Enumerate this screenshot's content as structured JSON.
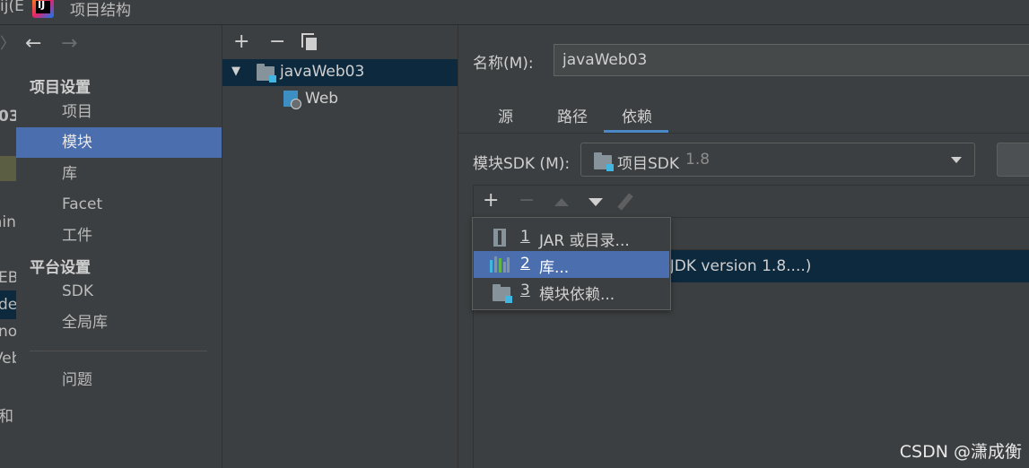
{
  "window": {
    "bg_title_fragment": "ij(E",
    "app_logo_text": "IJ",
    "title": "项目结构"
  },
  "background_ide": {
    "fragments": [
      "〉",
      "03",
      "ain",
      "EB",
      "de",
      "no",
      "Veb",
      "和"
    ]
  },
  "nav": {
    "back_icon": "arrow-left-icon",
    "forward_icon": "arrow-right-icon",
    "section_project": "项目设置",
    "items_project": [
      "项目",
      "模块",
      "库",
      "Facet",
      "工件"
    ],
    "section_platform": "平台设置",
    "items_platform": [
      "SDK",
      "全局库"
    ],
    "problems": "问题",
    "selected": "模块"
  },
  "tree": {
    "toolbar": {
      "add": "+",
      "remove": "−"
    },
    "module": "javaWeb03",
    "facet": "Web"
  },
  "content": {
    "name_label": "名称(M):",
    "name_value": "javaWeb03",
    "tabs": [
      "源",
      "路径",
      "依赖"
    ],
    "active_tab": "依赖",
    "sdk_label": "模块SDK (M):",
    "sdk_value": "项目SDK",
    "sdk_version": "1.8",
    "deps_toolbar": {
      "add": "+",
      "remove": "−"
    },
    "deps_row_text": "nJDK version 1.8....)"
  },
  "popup": {
    "items": [
      {
        "num": "1",
        "label": "JAR 或目录...",
        "icon": "jar-icon"
      },
      {
        "num": "2",
        "label": "库...",
        "icon": "library-icon"
      },
      {
        "num": "3",
        "label": "模块依赖...",
        "icon": "module-folder-icon"
      }
    ],
    "selected_index": 1
  },
  "watermark": "CSDN @潇成衡",
  "colors": {
    "selection": "#4b6eaf",
    "tree_selection": "#0d293e",
    "accent": "#4a88c7",
    "panel": "#3c3f41"
  }
}
